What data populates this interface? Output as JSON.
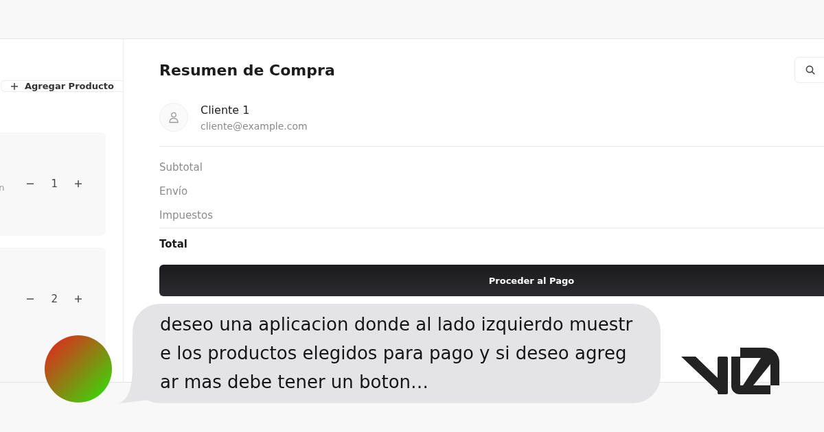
{
  "preview": {
    "products_panel": {
      "add_button": {
        "label": "Agregar Producto"
      },
      "items": [
        {
          "detail": "n",
          "quantity": "1"
        },
        {
          "quantity": "2"
        }
      ]
    },
    "summary": {
      "title": "Resumen de Compra",
      "customer": {
        "name": "Cliente 1",
        "email": "cliente@example.com"
      },
      "lines": [
        "Subtotal",
        "Envío",
        "Impuestos"
      ],
      "total": {
        "label": "Total"
      },
      "checkout_button": {
        "label": "Proceder al Pago"
      }
    }
  },
  "chat": {
    "message": "deseo una aplicacion donde al lado izquierdo muestre los productos elegidos para pago y si deseo agregar mas debe tener un boton…"
  }
}
